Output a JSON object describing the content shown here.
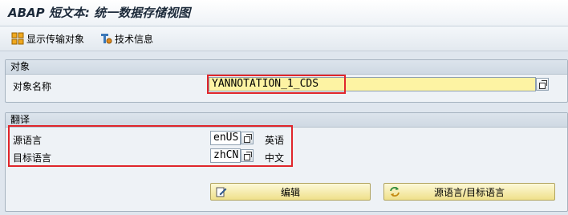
{
  "title": "ABAP 短文本: 统一数据存储视图",
  "toolbar": {
    "show_transport_label": "显示传输对象",
    "tech_info_label": "技术信息"
  },
  "object_group": {
    "header": "对象",
    "object_name_label": "对象名称",
    "object_name_value": "YANNOTATION_1_CDS"
  },
  "translation_group": {
    "header": "翻译",
    "source_lang_label": "源语言",
    "source_lang_value": "enUS",
    "source_lang_name": "英语",
    "target_lang_label": "目标语言",
    "target_lang_value": "zhCN",
    "target_lang_name": "中文",
    "edit_button": "编辑",
    "swap_button": "源语言/目标语言"
  },
  "icons": [
    "transport-objects-icon",
    "technical-info-icon",
    "value-help-icon",
    "edit-icon",
    "swap-languages-icon"
  ],
  "colors": {
    "required_field": "#fdf3a3",
    "highlight": "#e0262b",
    "action_button": "#efe08a"
  }
}
